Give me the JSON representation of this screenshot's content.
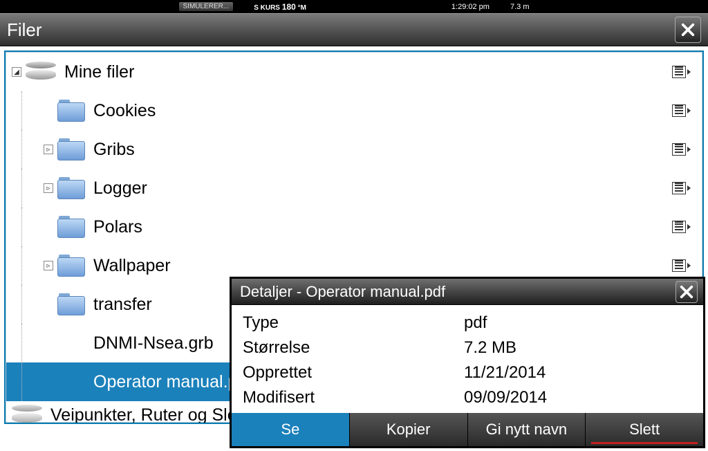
{
  "status": {
    "simulator": "SIMULERER...",
    "course_prefix": "S",
    "course_label": "KURS",
    "course_value": "180",
    "course_unit": "°M",
    "time": "1:29:02 pm",
    "depth": "7.3 m"
  },
  "window": {
    "title": "Filer"
  },
  "tree": {
    "root": {
      "label": "Mine filer"
    },
    "items": [
      {
        "label": "Cookies",
        "type": "folder",
        "expandable": false
      },
      {
        "label": "Gribs",
        "type": "folder",
        "expandable": true
      },
      {
        "label": "Logger",
        "type": "folder",
        "expandable": true
      },
      {
        "label": "Polars",
        "type": "folder",
        "expandable": false
      },
      {
        "label": "Wallpaper",
        "type": "folder",
        "expandable": true
      },
      {
        "label": "transfer",
        "type": "folder",
        "expandable": false
      },
      {
        "label": "DNMI-Nsea.grb",
        "type": "file"
      },
      {
        "label": "Operator manual.pdf",
        "type": "file",
        "selected": true
      },
      {
        "label": "Veipunkter, Ruter og Slep",
        "type": "drive-sub"
      }
    ]
  },
  "details": {
    "title": "Detaljer - Operator manual.pdf",
    "props": {
      "type_label": "Type",
      "type_value": "pdf",
      "size_label": "Størrelse",
      "size_value": "7.2 MB",
      "created_label": "Opprettet",
      "created_value": "11/21/2014",
      "modified_label": "Modifisert",
      "modified_value": "09/09/2014"
    },
    "actions": {
      "view": "Se",
      "copy": "Kopier",
      "rename": "Gi nytt navn",
      "delete": "Slett"
    }
  }
}
